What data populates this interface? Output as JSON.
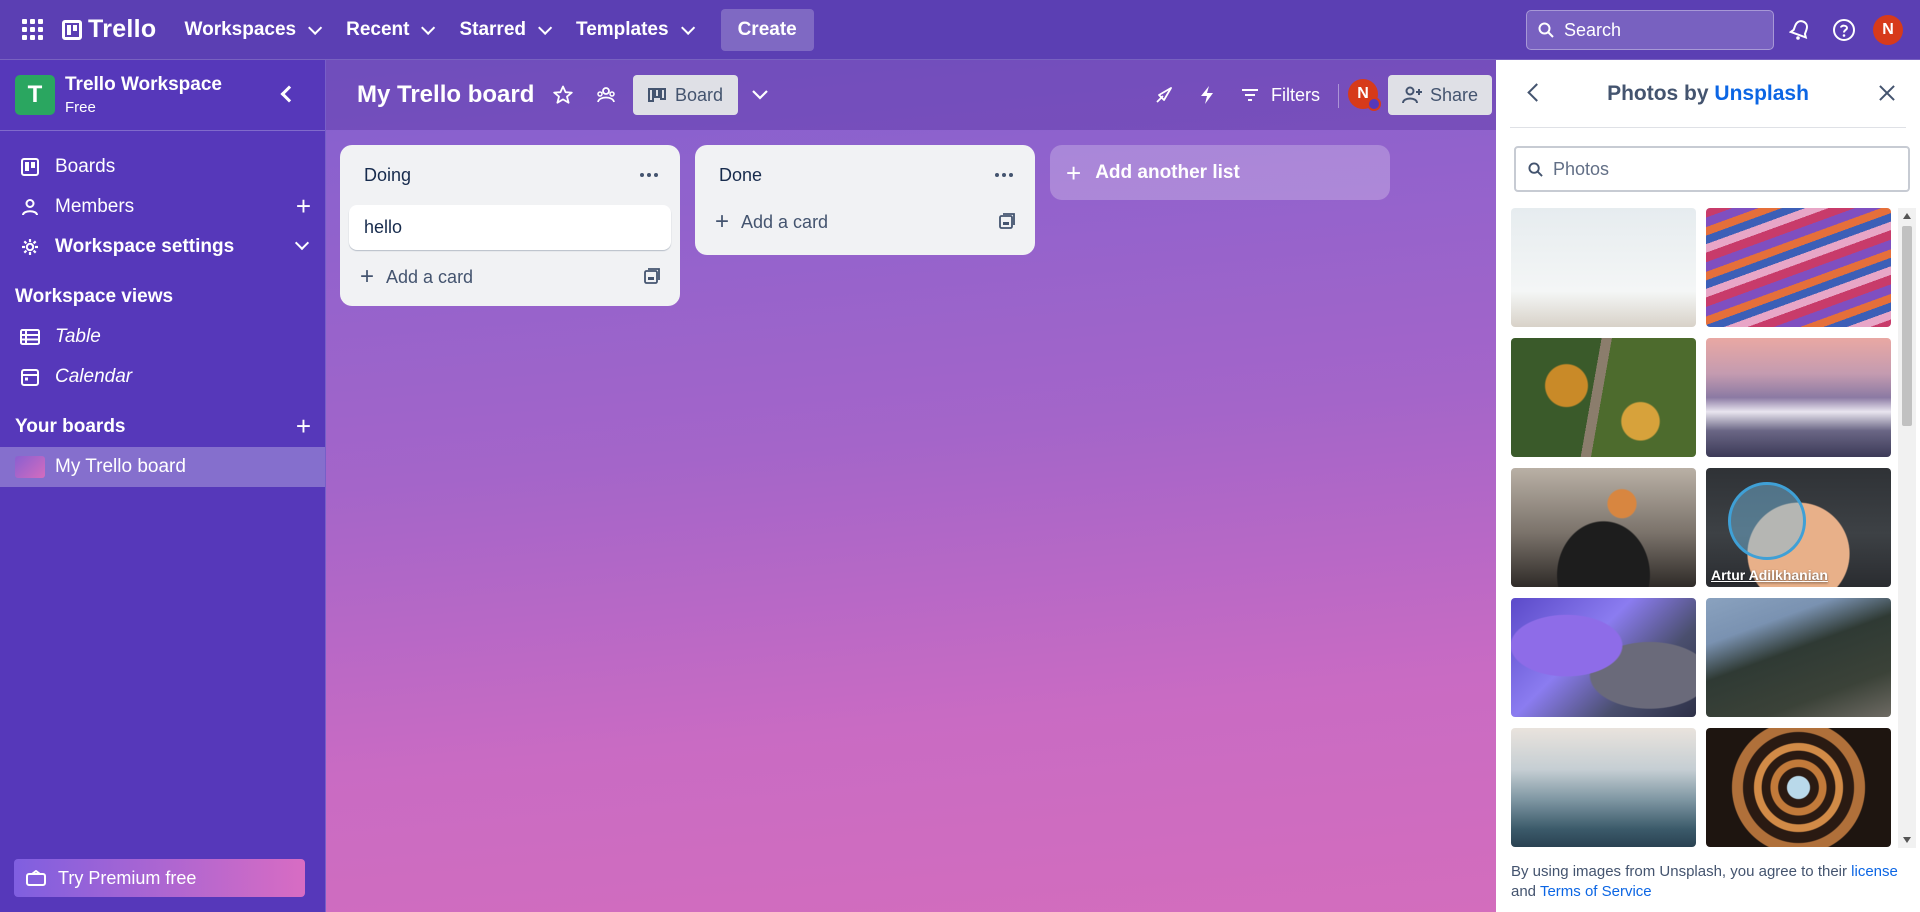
{
  "header": {
    "logo_text": "Trello",
    "nav": [
      "Workspaces",
      "Recent",
      "Starred",
      "Templates"
    ],
    "create_label": "Create",
    "search_placeholder": "Search",
    "avatar_initial": "N"
  },
  "sidebar": {
    "workspace_initial": "T",
    "workspace_name": "Trello Workspace",
    "workspace_plan": "Free",
    "items": [
      {
        "label": "Boards"
      },
      {
        "label": "Members"
      },
      {
        "label": "Workspace settings"
      }
    ],
    "views_heading": "Workspace views",
    "views": [
      {
        "label": "Table"
      },
      {
        "label": "Calendar"
      }
    ],
    "your_boards_heading": "Your boards",
    "boards": [
      {
        "label": "My Trello board"
      }
    ],
    "premium_label": "Try Premium free"
  },
  "board": {
    "title": "My Trello board",
    "view_label": "Board",
    "filters_label": "Filters",
    "share_label": "Share",
    "avatar_initial": "N",
    "lists": [
      {
        "title": "Doing",
        "cards": [
          "hello"
        ],
        "add_card_label": "Add a card"
      },
      {
        "title": "Done",
        "cards": [],
        "add_card_label": "Add a card"
      }
    ],
    "add_list_label": "Add another list"
  },
  "panel": {
    "title_prefix": "Photos by ",
    "title_brand": "Unsplash",
    "search_placeholder": "Photos",
    "hover_credit": "Artur Adilkhanian",
    "terms_prefix": "By using images from Unsplash, you agree to their ",
    "terms_license": "license",
    "terms_and": " and ",
    "terms_tos": "Terms of Service"
  },
  "colors": {
    "header": "#5b3fb3",
    "sidebar": "#5638ba",
    "accent_link": "#0c66e4",
    "avatar": "#d73a1a"
  }
}
